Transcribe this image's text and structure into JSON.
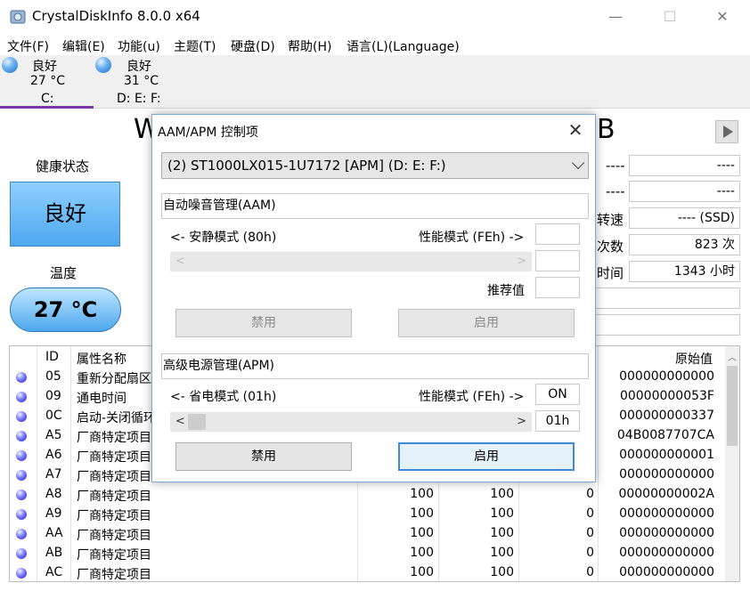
{
  "window": {
    "title": "CrystalDiskInfo 8.0.0 x64",
    "minimize": "—",
    "maximize": "☐",
    "close": "✕"
  },
  "menu": [
    "文件(F)",
    "编辑(E)",
    "功能(u)",
    "主题(T)",
    "硬盘(D)",
    "帮助(H)",
    "语言(L)(Language)"
  ],
  "disks": [
    {
      "status": "良好",
      "temp": "27 °C",
      "letters": "C:"
    },
    {
      "status": "良好",
      "temp": "31 °C",
      "letters": "D: E: F:"
    }
  ],
  "panel": {
    "health_label": "健康状态",
    "health_value": "良好",
    "temp_label": "温度",
    "temp_value": "27 °C",
    "title_left": "W",
    "title_right": "B"
  },
  "info_right": [
    {
      "label": "",
      "value": "----",
      "pre": "----"
    },
    {
      "label": "",
      "value": "----",
      "pre": "----"
    },
    {
      "label": "转速",
      "value": "---- (SSD)"
    },
    {
      "label": "次数",
      "value": "823 次"
    },
    {
      "label": "时间",
      "value": "1343 小时"
    }
  ],
  "table": {
    "headers": {
      "id": "ID",
      "name": "属性名称",
      "raw": "原始值"
    },
    "rows": [
      {
        "id": "05",
        "name": "重新分配扇区",
        "cur": "",
        "worst": "",
        "thr": "",
        "raw": "000000000000"
      },
      {
        "id": "09",
        "name": "通电时间",
        "cur": "",
        "worst": "",
        "thr": "",
        "raw": "00000000053F"
      },
      {
        "id": "0C",
        "name": "启动-关闭循环",
        "cur": "",
        "worst": "",
        "thr": "",
        "raw": "000000000337"
      },
      {
        "id": "A5",
        "name": "厂商特定项目",
        "cur": "",
        "worst": "",
        "thr": "",
        "raw": "04B0087707CA"
      },
      {
        "id": "A6",
        "name": "厂商特定项目",
        "cur": "",
        "worst": "",
        "thr": "",
        "raw": "000000000001"
      },
      {
        "id": "A7",
        "name": "厂商特定项目",
        "cur": "",
        "worst": "",
        "thr": "",
        "raw": "000000000000"
      },
      {
        "id": "A8",
        "name": "厂商特定项目",
        "cur": "100",
        "worst": "100",
        "thr": "0",
        "raw": "00000000002A"
      },
      {
        "id": "A9",
        "name": "厂商特定项目",
        "cur": "100",
        "worst": "100",
        "thr": "0",
        "raw": "000000000000"
      },
      {
        "id": "AA",
        "name": "厂商特定项目",
        "cur": "100",
        "worst": "100",
        "thr": "0",
        "raw": "000000000000"
      },
      {
        "id": "AB",
        "name": "厂商特定项目",
        "cur": "100",
        "worst": "100",
        "thr": "0",
        "raw": "000000000000"
      },
      {
        "id": "AC",
        "name": "厂商特定项目",
        "cur": "100",
        "worst": "100",
        "thr": "0",
        "raw": "000000000000"
      }
    ]
  },
  "dialog": {
    "title": "AAM/APM 控制项",
    "close": "✕",
    "drive_select": "(2) ST1000LX015-1U7172 [APM] (D: E: F:)",
    "aam": {
      "header": "自动噪音管理(AAM)",
      "left_label": "<- 安静模式 (80h)",
      "right_label": "性能模式 (FEh) ->",
      "value_top": "",
      "value_mid": "",
      "recommend_label": "推荐值",
      "recommend_value": "",
      "disable": "禁用",
      "enable": "启用"
    },
    "apm": {
      "header": "高级电源管理(APM)",
      "left_label": "<- 省电模式 (01h)",
      "right_label": "性能模式 (FEh) ->",
      "state": "ON",
      "value": "01h",
      "disable": "禁用",
      "enable": "启用"
    }
  },
  "colors": {
    "accent": "#7b3aa8",
    "health_good": "#4ea7ee",
    "dialog_focus": "#3c8ad8"
  }
}
